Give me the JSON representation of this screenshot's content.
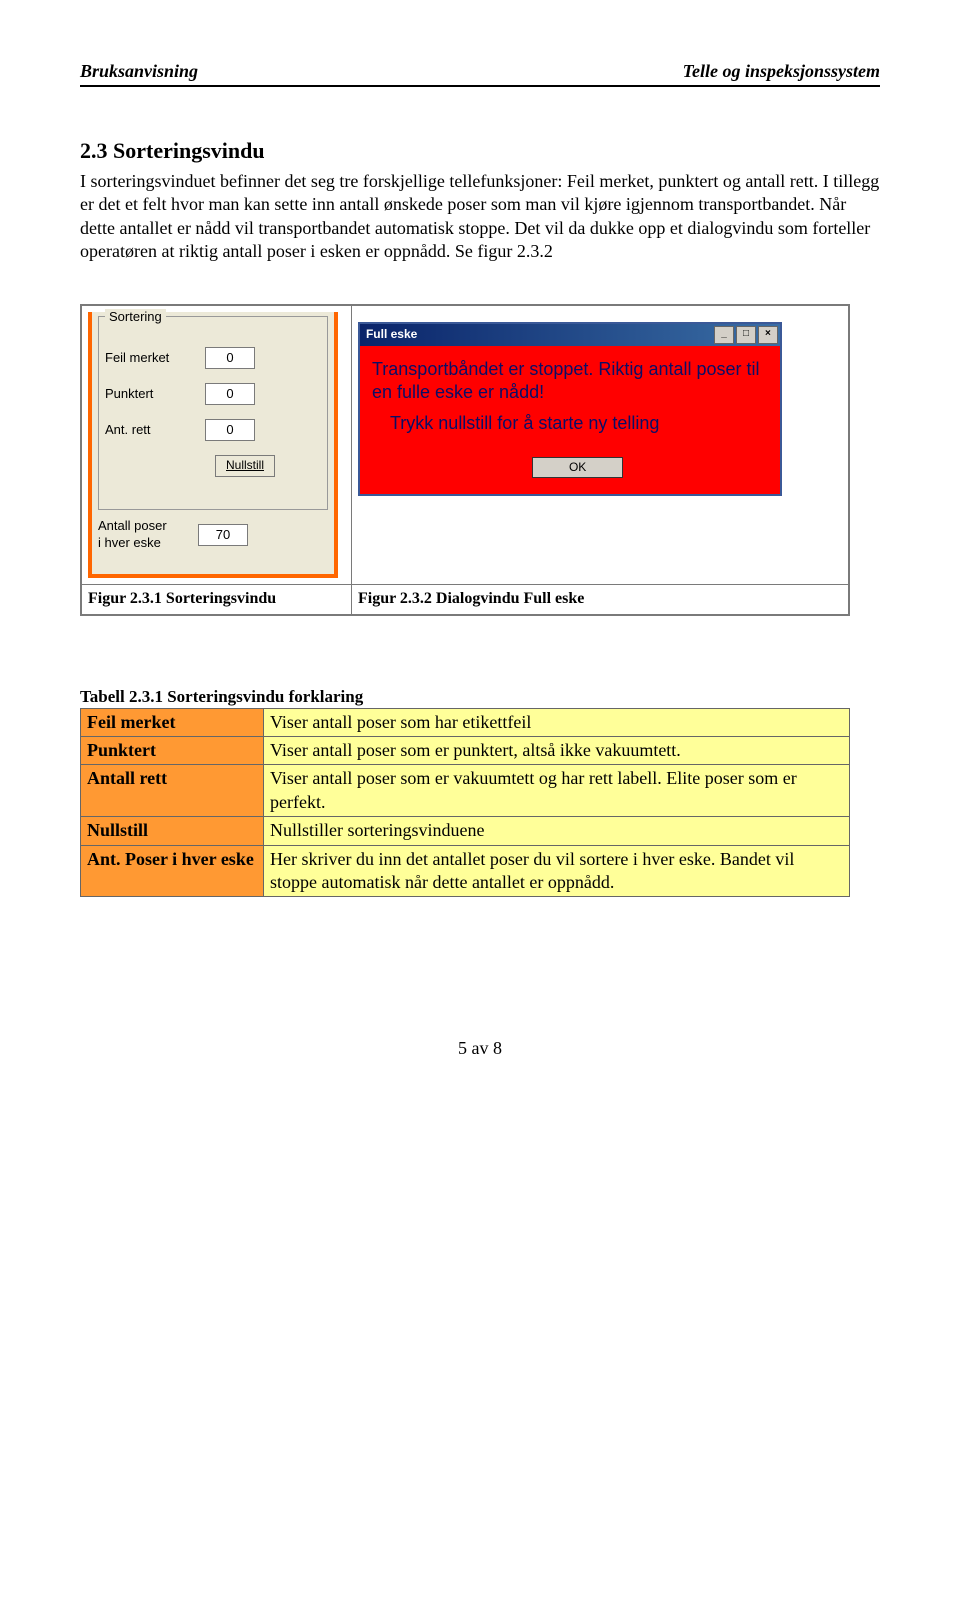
{
  "header": {
    "left": "Bruksanvisning",
    "right": "Telle og inspeksjonssystem"
  },
  "section": {
    "title": "2.3 Sorteringsvindu",
    "body": "I sorteringsvinduet befinner det seg tre forskjellige tellefunksjoner: Feil merket, punktert og antall rett. I tillegg er det et felt hvor man kan sette inn antall ønskede poser som man vil kjøre igjennom transportbandet. Når dette antallet er nådd vil transportbandet automatisk stoppe. Det vil da dukke opp et dialogvindu som forteller operatøren at riktig antall poser i esken er oppnådd. Se figur 2.3.2"
  },
  "sortering": {
    "group_title": "Sortering",
    "fields": {
      "feil_merket": {
        "label": "Feil merket",
        "value": "0"
      },
      "punktert": {
        "label": "Punktert",
        "value": "0"
      },
      "ant_rett": {
        "label": "Ant. rett",
        "value": "0"
      },
      "antall_poser": {
        "label_line1": "Antall poser",
        "label_line2": "i hver eske",
        "value": "70"
      }
    },
    "nullstill": "Nullstill"
  },
  "dialog": {
    "title": "Full eske",
    "msg1": "Transportbåndet er stoppet. Riktig antall poser til en fulle eske er nådd!",
    "msg2": "Trykk nullstill for å starte ny telling",
    "ok": "OK",
    "minimize": "_",
    "maximize": "□",
    "close": "×"
  },
  "captions": {
    "left": "Figur 2.3.1 Sorteringsvindu",
    "right": "Figur 2.3.2 Dialogvindu Full eske"
  },
  "table": {
    "title": "Tabell 2.3.1 Sorteringsvindu forklaring",
    "rows": [
      {
        "key": "Feil merket",
        "val": "Viser antall poser som har etikettfeil"
      },
      {
        "key": "Punktert",
        "val": "Viser antall poser som er punktert, altså ikke vakuumtett."
      },
      {
        "key": "Antall rett",
        "val": "Viser antall poser som er vakuumtett og har rett labell. Elite poser som er perfekt."
      },
      {
        "key": "Nullstill",
        "val": "Nullstiller sorteringsvinduene"
      },
      {
        "key": "Ant. Poser i hver eske",
        "val": "Her skriver du inn det antallet poser du vil sortere i hver eske. Bandet vil stoppe automatisk når dette antallet er oppnådd."
      }
    ]
  },
  "footer": "5 av 8"
}
